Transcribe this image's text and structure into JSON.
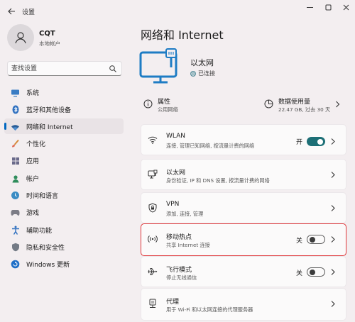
{
  "window": {
    "title": "设置",
    "minimize_icon": "minimize-icon",
    "maximize_icon": "maximize-icon",
    "close_icon": "close-icon"
  },
  "profile": {
    "name": "CQT",
    "account": "本地帐户"
  },
  "search": {
    "placeholder": "查找设置"
  },
  "sidebar": {
    "items": [
      {
        "label": "系统",
        "icon": "monitor-icon",
        "active": false
      },
      {
        "label": "蓝牙和其他设备",
        "icon": "bluetooth-icon",
        "active": false
      },
      {
        "label": "网络和 Internet",
        "icon": "wifi-diamond-icon",
        "active": true
      },
      {
        "label": "个性化",
        "icon": "brush-icon",
        "active": false
      },
      {
        "label": "应用",
        "icon": "apps-icon",
        "active": false
      },
      {
        "label": "帐户",
        "icon": "person-icon",
        "active": false
      },
      {
        "label": "时间和语言",
        "icon": "globe-clock-icon",
        "active": false
      },
      {
        "label": "游戏",
        "icon": "gamepad-icon",
        "active": false
      },
      {
        "label": "辅助功能",
        "icon": "accessibility-icon",
        "active": false
      },
      {
        "label": "隐私和安全性",
        "icon": "shield-icon",
        "active": false
      },
      {
        "label": "Windows 更新",
        "icon": "update-icon",
        "active": false
      }
    ]
  },
  "main": {
    "title": "网络和 Internet",
    "connection": {
      "name": "以太网",
      "status": "已连接"
    },
    "properties": {
      "title": "属性",
      "subtitle": "公用网络"
    },
    "data_usage": {
      "title": "数据使用量",
      "subtitle": "22.47 GB, 过去 30 天"
    },
    "cards": [
      {
        "title": "WLAN",
        "subtitle": "连接, 管理已知网络, 按流量计费的网络",
        "icon": "wifi-icon",
        "toggle_label": "开",
        "toggle_on": true
      },
      {
        "title": "以太网",
        "subtitle": "身份验证, IP 和 DNS 设置, 按流量计费的网络",
        "icon": "ethernet-icon"
      },
      {
        "title": "VPN",
        "subtitle": "添加, 连接, 管理",
        "icon": "vpn-shield-icon"
      },
      {
        "title": "移动热点",
        "subtitle": "共享 Internet 连接",
        "icon": "hotspot-icon",
        "toggle_label": "关",
        "toggle_on": false
      },
      {
        "title": "飞行模式",
        "subtitle": "停止无线通信",
        "icon": "airplane-icon",
        "toggle_label": "关",
        "toggle_on": false
      },
      {
        "title": "代理",
        "subtitle": "用于 Wi-Fi 和以太网连接的代理服务器",
        "icon": "proxy-icon"
      }
    ]
  },
  "colors": {
    "accent": "#0067c0",
    "toggle_on": "#1d6f76",
    "highlight": "#e0373a",
    "background": "#f3eef0"
  }
}
